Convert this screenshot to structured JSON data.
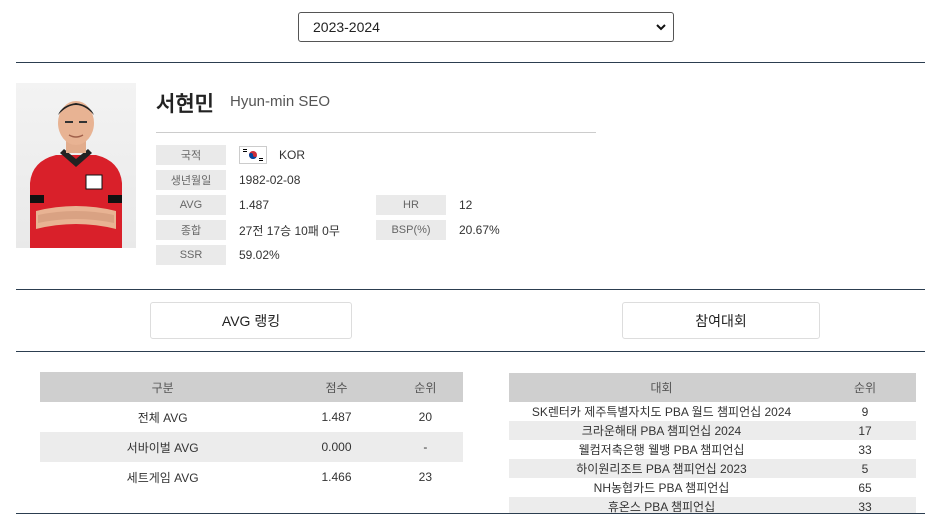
{
  "season": {
    "selected": "2023-2024"
  },
  "player": {
    "name_ko": "서현민",
    "name_en": "Hyun-min SEO",
    "info": {
      "nationality_label": "국적",
      "nationality_value": "KOR",
      "birth_label": "생년월일",
      "birth_value": "1982-02-08",
      "avg_label": "AVG",
      "avg_value": "1.487",
      "hr_label": "HR",
      "hr_value": "12",
      "total_label": "종합",
      "total_value": "27전 17승 10패 0무",
      "bsp_label": "BSP(%)",
      "bsp_value": "20.67%",
      "ssr_label": "SSR",
      "ssr_value": "59.02%"
    }
  },
  "tabs": {
    "avg_ranking": "AVG 랭킹",
    "tournaments": "참여대회"
  },
  "avg_table": {
    "headers": [
      "구분",
      "점수",
      "순위"
    ],
    "rows": [
      [
        "전체 AVG",
        "1.487",
        "20"
      ],
      [
        "서바이벌 AVG",
        "0.000",
        "-"
      ],
      [
        "세트게임 AVG",
        "1.466",
        "23"
      ]
    ]
  },
  "tour_table": {
    "headers": [
      "대회",
      "순위"
    ],
    "rows": [
      [
        "SK렌터카 제주특별자치도 PBA 월드 챔피언십 2024",
        "9"
      ],
      [
        "크라운해태 PBA 챔피언십 2024",
        "17"
      ],
      [
        "웰컴저축은행 웰뱅 PBA 챔피언십",
        "33"
      ],
      [
        "하이원리조트 PBA 챔피언십 2023",
        "5"
      ],
      [
        "NH농협카드 PBA 챔피언십",
        "65"
      ],
      [
        "휴온스 PBA 챔피언십",
        "33"
      ]
    ]
  }
}
